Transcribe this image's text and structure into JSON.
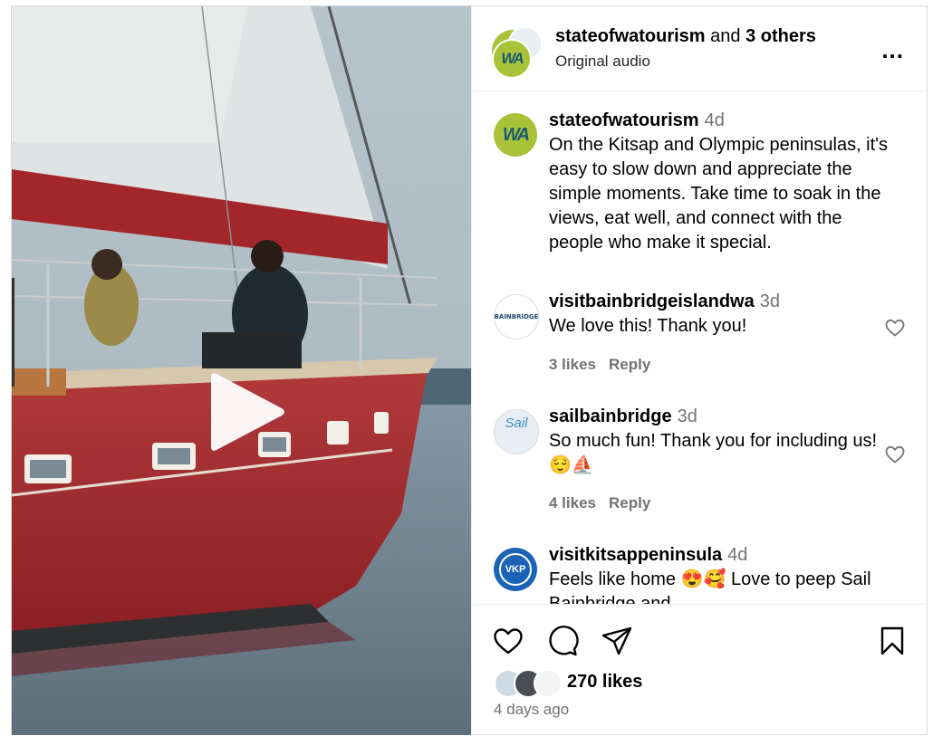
{
  "header": {
    "user": "stateofwatourism",
    "connector": " and ",
    "others": "3 others",
    "subtitle": "Original audio",
    "more_label": "...",
    "avatar_text": "WA"
  },
  "caption": {
    "user": "stateofwatourism",
    "time": "4d",
    "text": "On the Kitsap and Olympic peninsulas, it's easy to slow down and appreciate the simple moments. Take time to soak in the views, eat well, and connect with the people who make it special.",
    "avatar_text": "WA"
  },
  "comments": [
    {
      "user": "visitbainbridgeislandwa",
      "time": "3d",
      "text": "We love this! Thank you!",
      "likes": "3 likes",
      "reply": "Reply",
      "avatar_text": "BAINBRIDGE"
    },
    {
      "user": "sailbainbridge",
      "time": "3d",
      "text": "So much fun! Thank you for including us! 😌⛵",
      "likes": "4 likes",
      "reply": "Reply",
      "avatar_text": "Sail"
    },
    {
      "user": "visitkitsappeninsula",
      "time": "4d",
      "text": "Feels like home 😍🥰 Love to peep Sail Bainbridge and",
      "avatar_text": "VKP"
    }
  ],
  "footer": {
    "likes": "270 likes",
    "ago": "4 days ago"
  },
  "icons": {
    "play": "play-icon",
    "like": "heart-icon",
    "comment": "comment-icon",
    "share": "paper-plane-icon",
    "save": "bookmark-icon",
    "more": "more-horizontal-icon"
  },
  "colors": {
    "wa_green": "#a9c23a",
    "wa_teal": "#1a5b6d",
    "vkp_blue": "#1c63b8",
    "muted": "#737373",
    "hull_red": "#a8262b"
  }
}
